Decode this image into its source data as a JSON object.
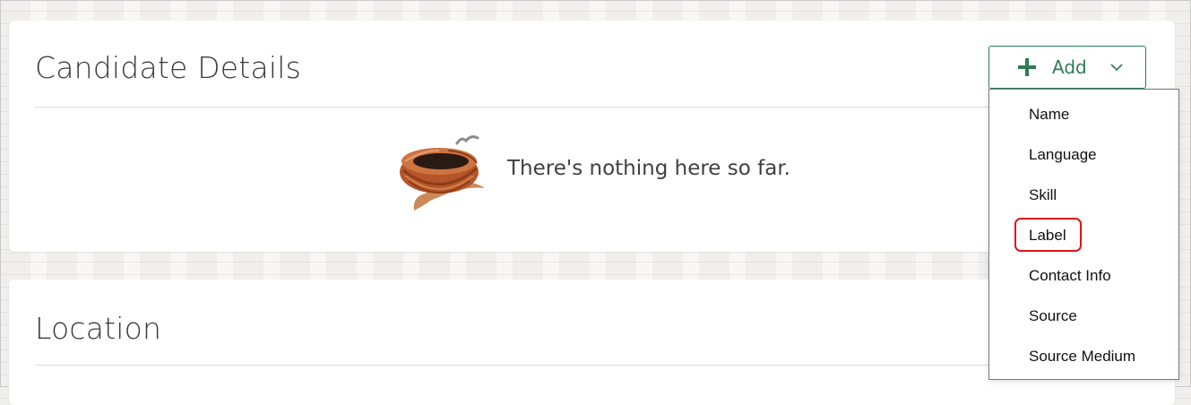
{
  "candidate_details": {
    "title": "Candidate Details",
    "empty_message": "There's nothing here so far.",
    "add_button": {
      "label": "Add",
      "icon": "plus-icon",
      "dropdown_icon": "chevron-down-icon",
      "accent_color": "#2e7d52"
    },
    "add_menu": {
      "items": [
        {
          "label": "Name"
        },
        {
          "label": "Language"
        },
        {
          "label": "Skill"
        },
        {
          "label": "Label"
        },
        {
          "label": "Contact Info"
        },
        {
          "label": "Source"
        },
        {
          "label": "Source Medium"
        }
      ],
      "highlighted_item": "Label",
      "highlight_color": "#e01414"
    }
  },
  "location": {
    "title": "Location"
  }
}
